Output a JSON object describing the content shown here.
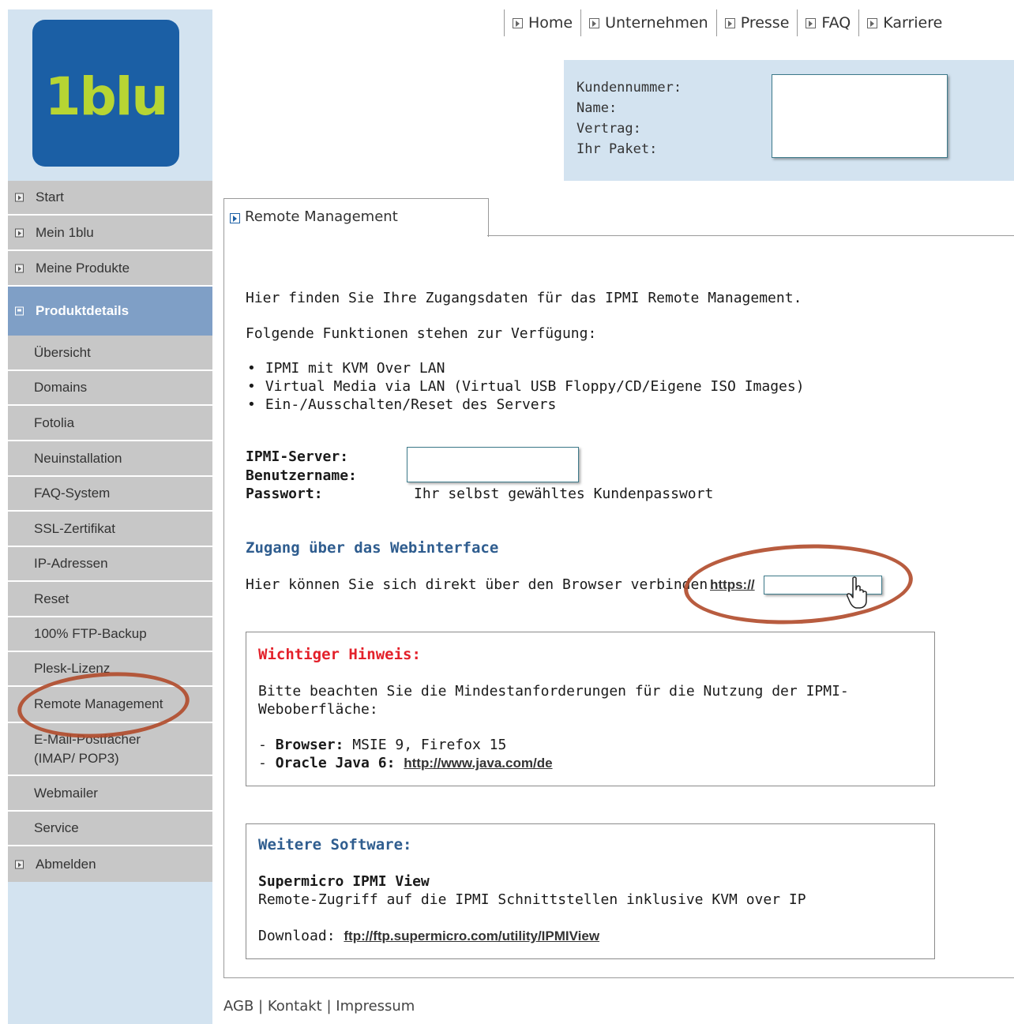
{
  "brand": {
    "logo_text": "1blu",
    "logo_color": "#b7d533",
    "logo_bg": "#1b5fa5"
  },
  "header": {
    "nav": [
      "Home",
      "Unternehmen",
      "Presse",
      "FAQ",
      "Karriere"
    ],
    "customer_labels": [
      "Kundennummer:",
      "Name:",
      "Vertrag:",
      "Ihr Paket:"
    ]
  },
  "sidebar": {
    "top_items": [
      "Start",
      "Mein 1blu",
      "Meine Produkte"
    ],
    "active_item": "Produktdetails",
    "sub_items": [
      "Übersicht",
      "Domains",
      "Fotolia",
      "Neuinstallation",
      "FAQ-System",
      "SSL-Zertifikat",
      "IP-Adressen",
      "Reset",
      "100% FTP-Backup",
      "Plesk-Lizenz",
      "Remote Management",
      "E-Mail-Postfächer (IMAP/ POP3)",
      "Webmailer",
      "Service"
    ],
    "logout": "Abmelden"
  },
  "content": {
    "tab": "Remote Management",
    "intro": "Hier finden Sie Ihre Zugangsdaten für das IPMI Remote Management.",
    "features_intro": "Folgende Funktionen stehen zur Verfügung:",
    "features": [
      "IPMI mit KVM Over LAN",
      "Virtual Media via LAN (Virtual USB Floppy/CD/Eigene ISO Images)",
      "Ein-/Ausschalten/Reset des Servers"
    ],
    "ipmi_server_label": "IPMI-Server:",
    "username_label": "Benutzername:",
    "password_label": "Passwort:",
    "password_value": "Ihr selbst gewähltes Kundenpasswort",
    "web_heading": "Zugang über das Webinterface",
    "web_text": "Hier können Sie sich direkt über den Browser verbinden:",
    "web_link": "https://",
    "hint": {
      "title": "Wichtiger Hinweis:",
      "body": "Bitte beachten Sie die Mindestanforderungen für die Nutzung der IPMI-Weboberfläche:",
      "browser_label": "Browser:",
      "browser_value": "MSIE 9, Firefox 15",
      "java_label": "Oracle Java 6:",
      "java_link": "http://www.java.com/de"
    },
    "software": {
      "title": "Weitere Software:",
      "name": "Supermicro IPMI View",
      "desc": "Remote-Zugriff auf die IPMI Schnittstellen inklusive KVM over IP",
      "download_label": "Download:",
      "download_link": "ftp://ftp.supermicro.com/utility/IPMIView"
    }
  },
  "footer": {
    "links": [
      "AGB",
      "Kontakt",
      "Impressum"
    ],
    "separator": "|"
  },
  "colors": {
    "accent": "#7f9fc6",
    "nav_bg": "#c7c7c7",
    "panel_bg": "#d3e3f0",
    "warning": "#e3202a",
    "heading": "#2f5d8f",
    "annotation": "#b04a2a"
  }
}
